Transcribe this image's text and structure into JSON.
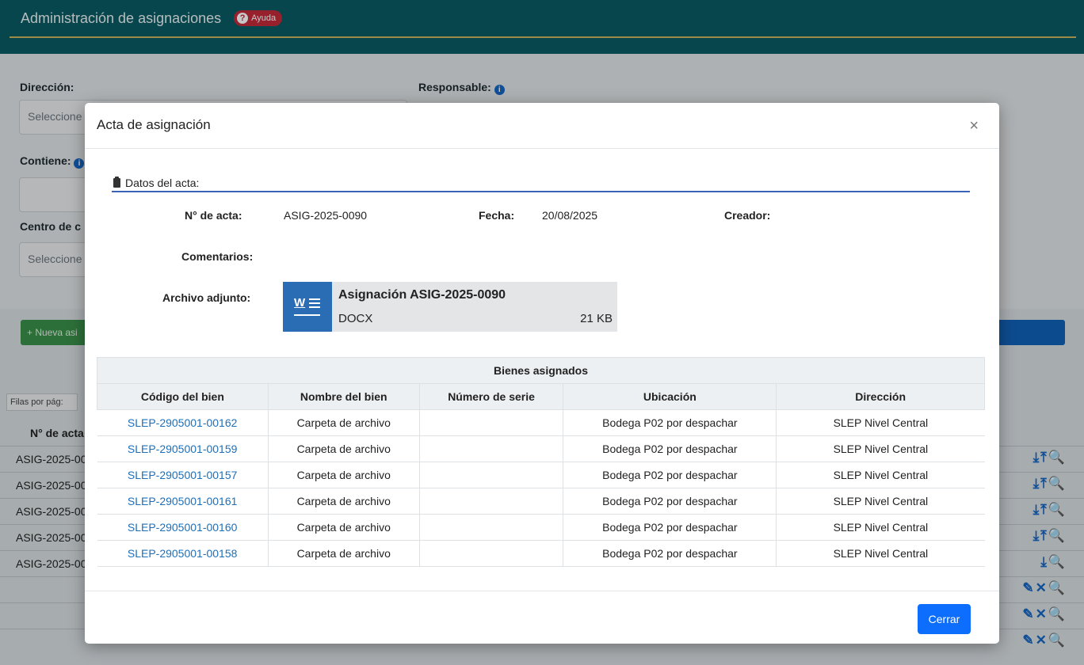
{
  "background": {
    "title": "Administración de asignaciones",
    "help_label": "Ayuda",
    "direccion_label": "Dirección:",
    "direccion_placeholder": "Seleccione",
    "responsable_label": "Responsable:",
    "contiene_label": "Contiene:",
    "centro_label": "Centro de c",
    "centro_placeholder": "Seleccione",
    "new_button": "+ Nueva asi",
    "filas_label": "Filas por pág:",
    "acta_header": "N° de acta",
    "rows": [
      {
        "acta": "ASIG-2025-00",
        "icons": "⤓⤒🔍"
      },
      {
        "acta": "ASIG-2025-00",
        "icons": "⤓⤒🔍"
      },
      {
        "acta": "ASIG-2025-00",
        "icons": "⤓⤒🔍"
      },
      {
        "acta": "ASIG-2025-00",
        "icons": "⤓⤒🔍"
      },
      {
        "acta": "ASIG-2025-00",
        "icons": "⤓🔍"
      },
      {
        "acta": "",
        "icons": "✎✕🔍"
      },
      {
        "acta": "",
        "icons": "✎✕🔍"
      },
      {
        "acta": "",
        "icons": "✎✕🔍"
      }
    ]
  },
  "modal": {
    "title": "Acta de asignación",
    "close_symbol": "×",
    "section_label": "Datos del acta:",
    "acta_label": "N° de acta:",
    "acta_value": "ASIG-2025-0090",
    "fecha_label": "Fecha:",
    "fecha_value": "20/08/2025",
    "creador_label": "Creador:",
    "comentarios_label": "Comentarios:",
    "archivo_label": "Archivo adjunto:",
    "attachment": {
      "name": "Asignación ASIG-2025-0090",
      "type": "DOCX",
      "size": "21 KB"
    },
    "table": {
      "group_header": "Bienes asignados",
      "columns": [
        "Código del bien",
        "Nombre del bien",
        "Número de serie",
        "Ubicación",
        "Dirección"
      ],
      "rows": [
        [
          "SLEP-2905001-00162",
          "Carpeta de archivo",
          "",
          "Bodega P02 por despachar",
          "SLEP Nivel Central"
        ],
        [
          "SLEP-2905001-00159",
          "Carpeta de archivo",
          "",
          "Bodega P02 por despachar",
          "SLEP Nivel Central"
        ],
        [
          "SLEP-2905001-00157",
          "Carpeta de archivo",
          "",
          "Bodega P02 por despachar",
          "SLEP Nivel Central"
        ],
        [
          "SLEP-2905001-00161",
          "Carpeta de archivo",
          "",
          "Bodega P02 por despachar",
          "SLEP Nivel Central"
        ],
        [
          "SLEP-2905001-00160",
          "Carpeta de archivo",
          "",
          "Bodega P02 por despachar",
          "SLEP Nivel Central"
        ],
        [
          "SLEP-2905001-00158",
          "Carpeta de archivo",
          "",
          "Bodega P02 por despachar",
          "SLEP Nivel Central"
        ]
      ]
    },
    "close_button": "Cerrar"
  }
}
